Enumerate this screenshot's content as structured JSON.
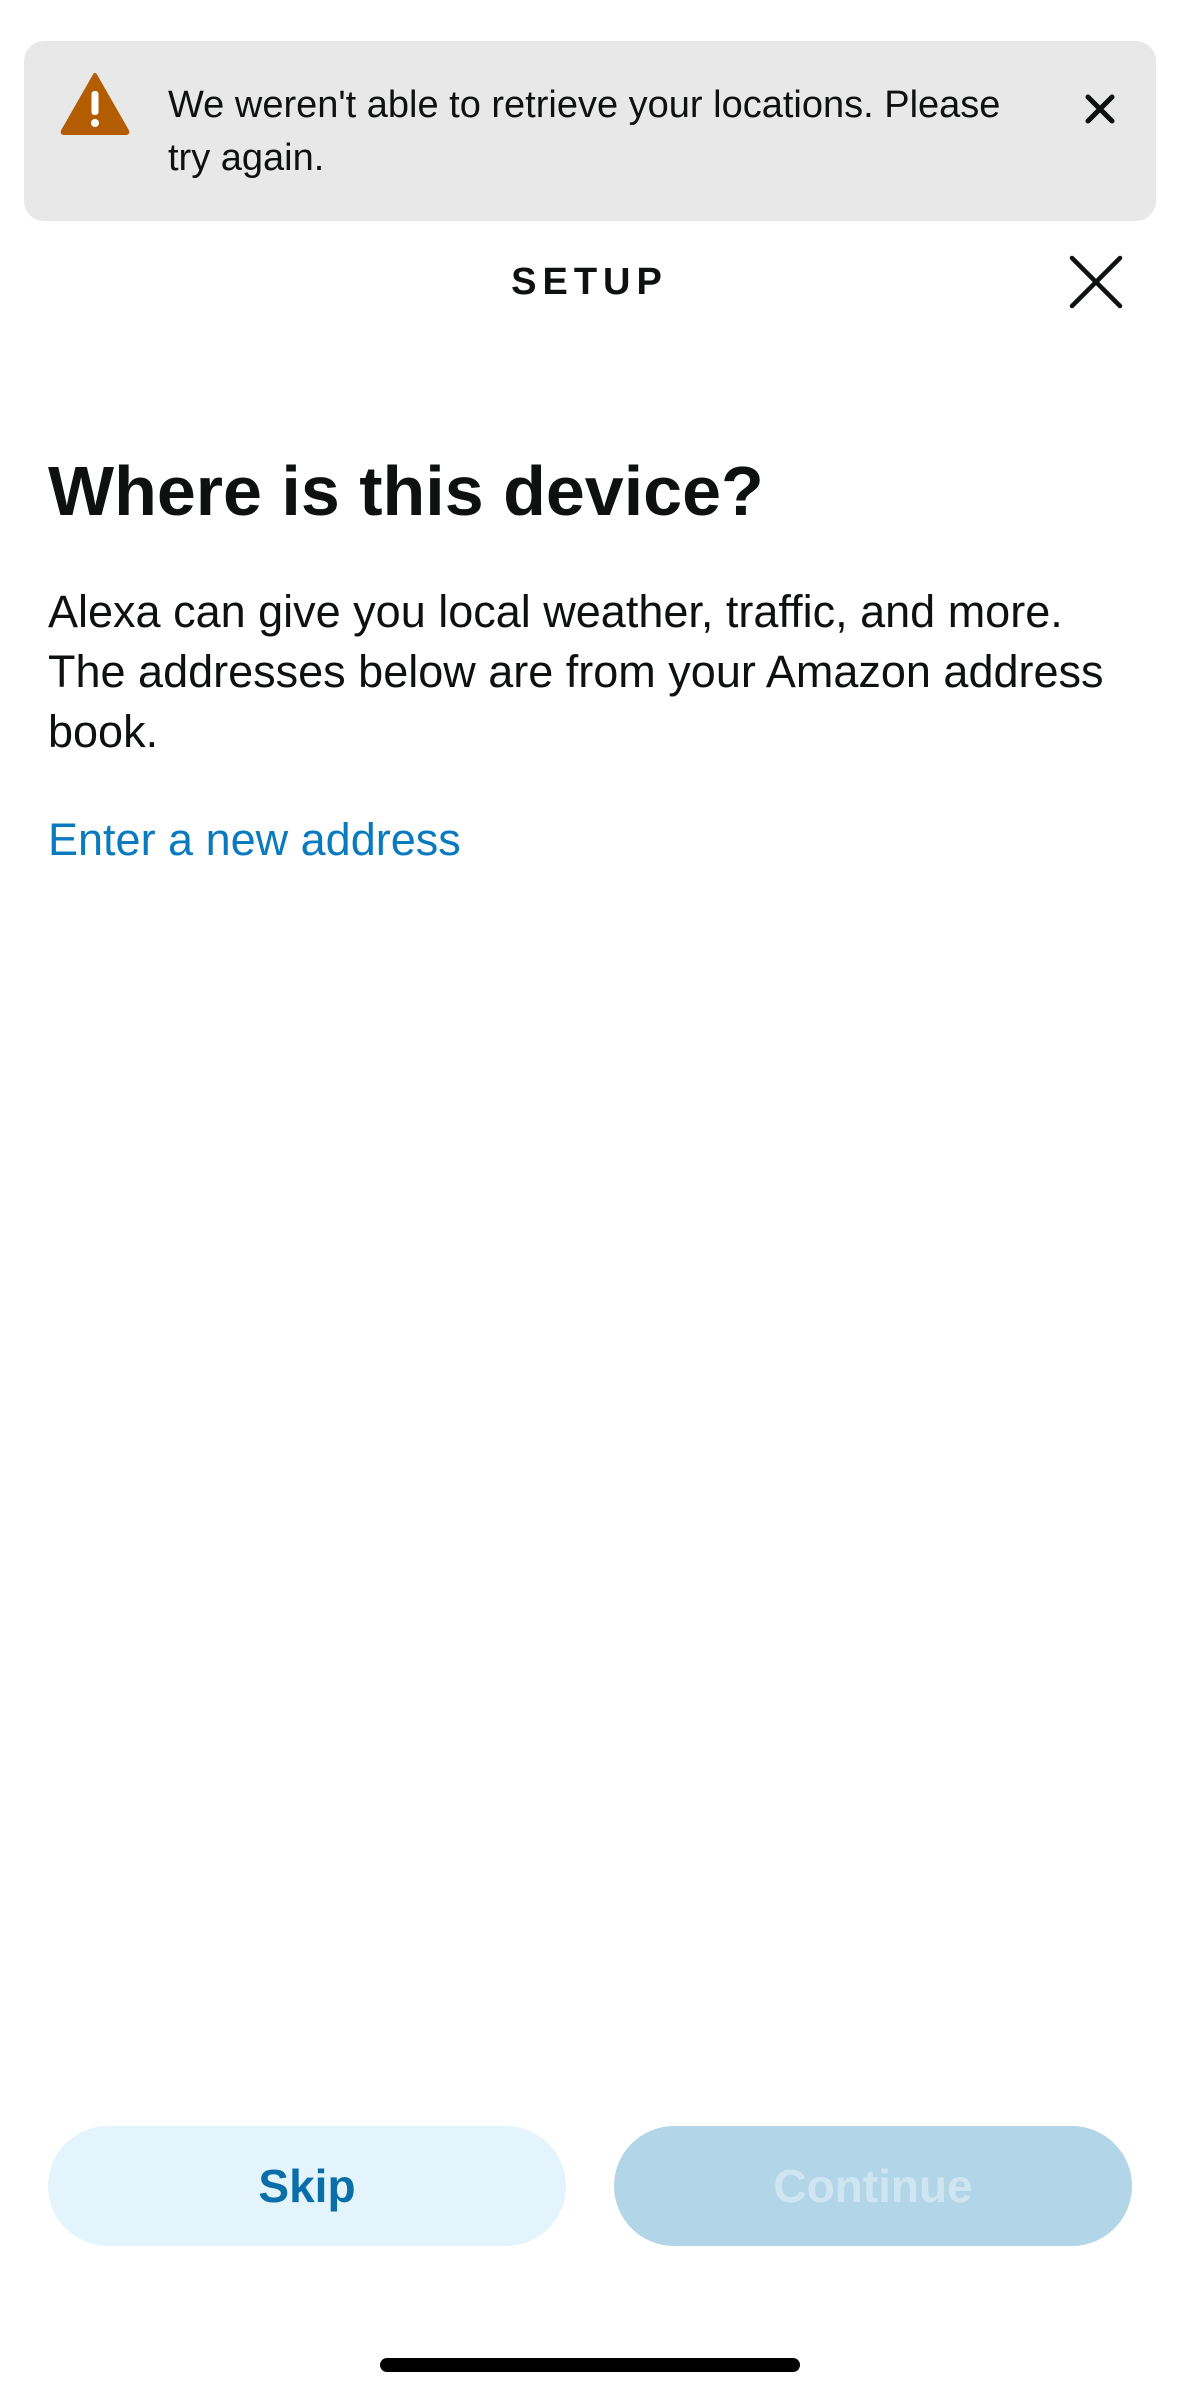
{
  "banner": {
    "icon": "warning-icon",
    "message": "We weren't able to retrieve your locations. Please try again.",
    "close_icon": "close-icon",
    "warning_color": "#b35c00"
  },
  "header": {
    "title": "SETUP",
    "close_icon": "close-icon"
  },
  "main": {
    "title": "Where is this device?",
    "description": "Alexa can give you local weather, traffic, and more. The addresses below are from your Amazon address book.",
    "new_address_link": "Enter a new address",
    "link_color": "#0a7abf"
  },
  "footer": {
    "skip_label": "Skip",
    "continue_label": "Continue",
    "continue_enabled": false
  }
}
